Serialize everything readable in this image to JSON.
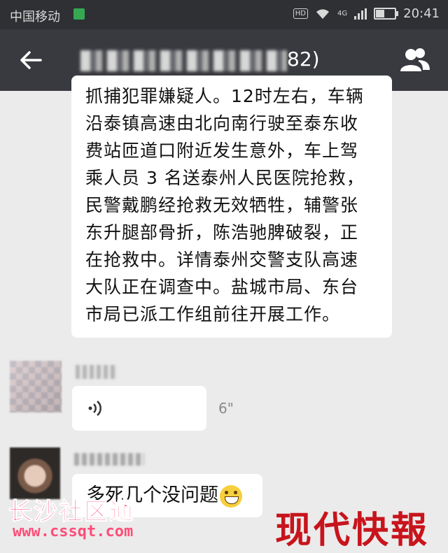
{
  "status_bar": {
    "carrier": "中国移动",
    "hd": "HD",
    "network": "4G",
    "time": "20:41"
  },
  "header": {
    "title_suffix": "82)"
  },
  "messages": {
    "text_lines": [
      "抓捕犯罪嫌疑人。12时左右，车辆",
      "沿泰镇高速由北向南行驶至泰东收",
      "费站匝道口附近发生意外，车上驾",
      "乘人员 3 名送泰州人民医院抢救，",
      "民警戴鹏经抢救无效牺牲，辅警张",
      "东升腿部骨折，陈浩驰脾破裂，正",
      "在抢救中。详情泰州交警支队高速",
      "大队正在调查中。盐城市局、东台",
      "市局已派工作组前往开展工作。"
    ],
    "voice_duration": "6\"",
    "reply_text": "多死几个没问题"
  },
  "watermarks": {
    "left_title": "长沙社区通",
    "left_url": "www.cssqt.com",
    "right": "现代快報"
  },
  "colors": {
    "status_bg": "#2f3033",
    "header_bg": "#393a3f",
    "chat_bg": "#ebebeb",
    "bubble": "#ffffff"
  }
}
